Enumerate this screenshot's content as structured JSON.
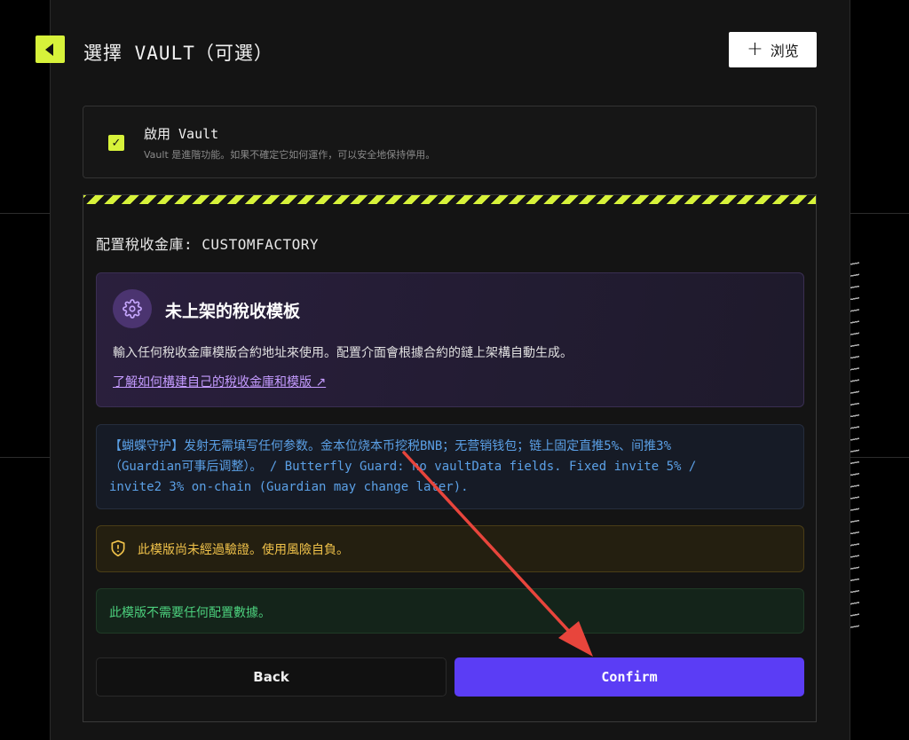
{
  "header": {
    "title": "選擇 VAULT（可選）",
    "browse_label": "浏览"
  },
  "vault": {
    "checked": true,
    "title": "啟用 Vault",
    "description": "Vault 是進階功能。如果不確定它如何運作，可以安全地保持停用。"
  },
  "config": {
    "label": "配置稅收金庫: CUSTOMFACTORY",
    "template": {
      "title": "未上架的稅收模板",
      "description": "輸入任何稅收金庫模版合約地址來使用。配置介面會根據合約的鏈上架構自動生成。",
      "link_text": "了解如何構建自己的稅收金庫和模版 ↗"
    },
    "info_lines": [
      "【蝴蝶守护】发射无需填写任何参数。金本位烧本币挖税BNB；无营销钱包；链上固定直推5%、间推3%",
      "（Guardian可事后调整）。 / Butterfly Guard: no vaultData fields. Fixed invite 5% /",
      "invite2 3% on-chain (Guardian may change later)."
    ],
    "warning": "此模版尚未經過驗證。使用風險自負。",
    "notice": "此模版不需要任何配置數據。"
  },
  "actions": {
    "back_label": "Back",
    "confirm_label": "Confirm"
  },
  "colors": {
    "accent": "#d7f23a",
    "primary": "#5b3df5",
    "annotation_arrow": "#e8453c"
  }
}
